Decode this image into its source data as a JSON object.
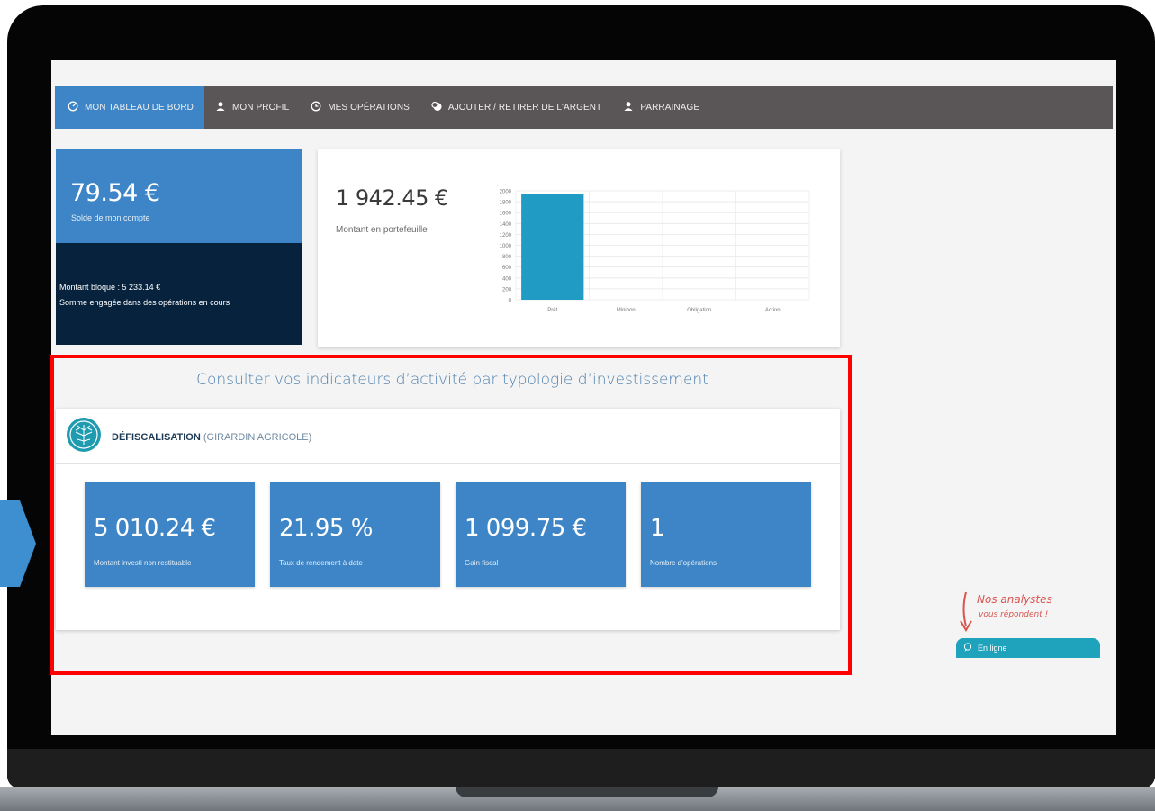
{
  "nav": {
    "items": [
      {
        "label": "MON TABLEAU DE BORD",
        "icon": "dashboard-icon"
      },
      {
        "label": "MON PROFIL",
        "icon": "user-icon"
      },
      {
        "label": "MES OPÉRATIONS",
        "icon": "history-icon"
      },
      {
        "label": "AJOUTER / RETIRER DE L'ARGENT",
        "icon": "euro-coin-icon"
      },
      {
        "label": "PARRAINAGE",
        "icon": "user-plus-icon"
      }
    ]
  },
  "balance": {
    "amount": "79.54 €",
    "label": "Solde de mon compte",
    "blocked": "Montant bloqué : 5 233.14 €",
    "blocked_note": "Somme engagée dans des opérations en cours"
  },
  "portfolio": {
    "amount": "1 942.45 €",
    "label": "Montant en portefeuille"
  },
  "chart_data": {
    "type": "bar",
    "categories": [
      "Prêt",
      "Minibon",
      "Obligation",
      "Action"
    ],
    "values": [
      1942.45,
      0,
      0,
      0
    ],
    "ylim": [
      0,
      2000
    ],
    "yticks": [
      "0",
      "200",
      "400",
      "600",
      "800",
      "1000",
      "1200",
      "1400",
      "1600",
      "1800",
      "2000"
    ],
    "bar_color": "#1f9bc4",
    "grid": true
  },
  "invest": {
    "title": "Consulter vos indicateurs d’activité par typologie d’investissement",
    "category": "DÉFISCALISATION",
    "subcategory": "(GIRARDIN AGRICOLE)",
    "stats": [
      {
        "value": "5 010.24 €",
        "label": "Montant investi non restituable"
      },
      {
        "value": "21.95 %",
        "label": "Taux de rendement à date"
      },
      {
        "value": "1 099.75 €",
        "label": "Gain fiscal"
      },
      {
        "value": "1",
        "label": "Nombre d'opérations"
      }
    ]
  },
  "chat": {
    "note_line1": "Nos analystes",
    "note_line2": "vous répondent !",
    "button": "En ligne"
  },
  "colors": {
    "primary_blue": "#3d85c6",
    "dark_navy": "#06223d",
    "nav_bg": "#5a5556",
    "teal": "#1fa3bd",
    "highlight_red": "#ff0000"
  }
}
